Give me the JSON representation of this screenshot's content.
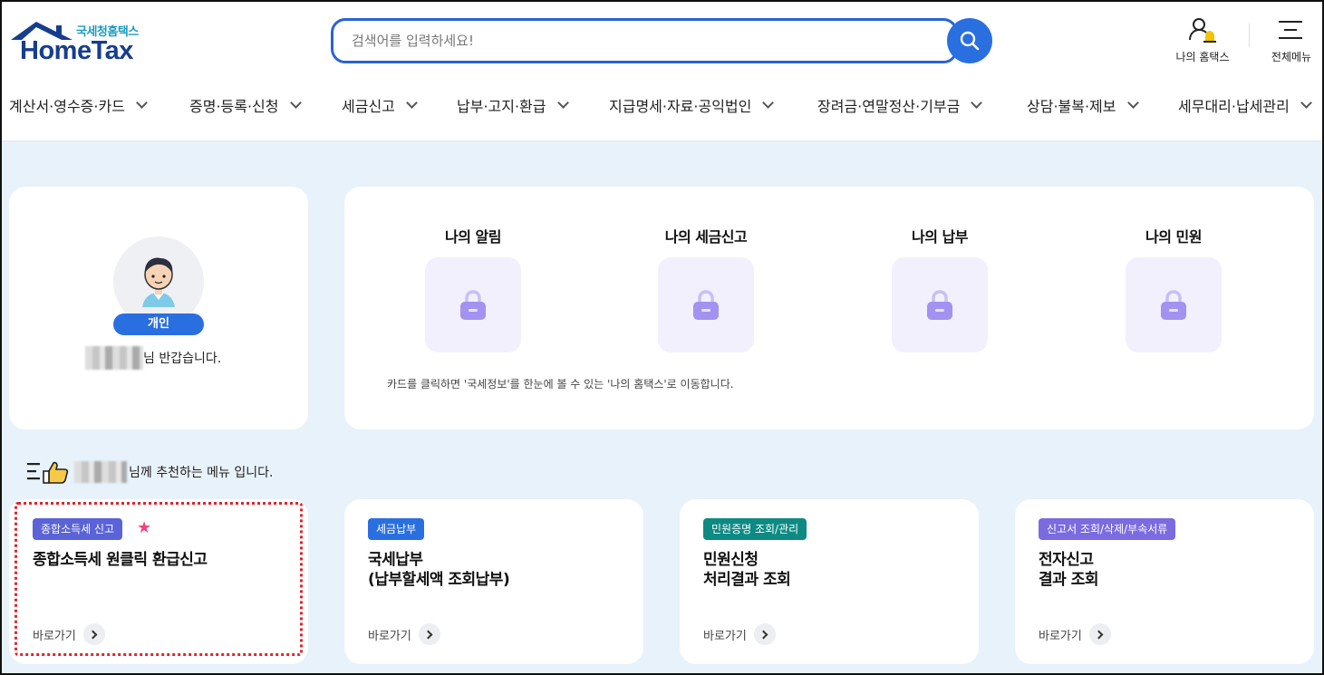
{
  "header": {
    "logo_sub": "국세청홈택스",
    "logo_main": "HomeTax",
    "search_placeholder": "검색어를 입력하세요!",
    "my_hometax_label": "나의 홈택스",
    "all_menu_label": "전체메뉴"
  },
  "nav": {
    "items": [
      "계산서·영수증·카드",
      "증명·등록·신청",
      "세금신고",
      "납부·고지·환급",
      "지급명세·자료·공익법인",
      "장려금·연말정산·기부금",
      "상담·불복·제보",
      "세무대리·납세관리"
    ]
  },
  "profile": {
    "badge": "개인",
    "greeting": "님 반갑습니다."
  },
  "my_section": {
    "columns": [
      "나의 알림",
      "나의 세금신고",
      "나의 납부",
      "나의 민원"
    ],
    "note": "카드를 클릭하면 '국세정보'를 한눈에 볼 수 있는 '나의 홈택스'로 이동합니다."
  },
  "recommend": {
    "text": "님께 추천하는 메뉴 입니다."
  },
  "menu_cards": [
    {
      "tag": "종합소득세 신고",
      "tag_color": "#5b63d8",
      "title": "종합소득세 원클릭 환급신고",
      "go": "바로가기",
      "starred": true
    },
    {
      "tag": "세금납부",
      "tag_color": "#2a6fe0",
      "title": "국세납부\n(납부할세액 조회납부)",
      "go": "바로가기",
      "starred": false
    },
    {
      "tag": "민원증명 조회/관리",
      "tag_color": "#0d8a83",
      "title": "민원신청\n처리결과 조회",
      "go": "바로가기",
      "starred": false
    },
    {
      "tag": "신고서 조회/삭제/부속서류",
      "tag_color": "#7b6be0",
      "title": "전자신고\n결과 조회",
      "go": "바로가기",
      "starred": false
    }
  ],
  "colors": {
    "brand_blue": "#2a6fe0",
    "logo_navy": "#173e8c",
    "main_bg": "#e8f2fa",
    "lock_purple": "#a392f0",
    "highlight_red": "#e0242c"
  }
}
